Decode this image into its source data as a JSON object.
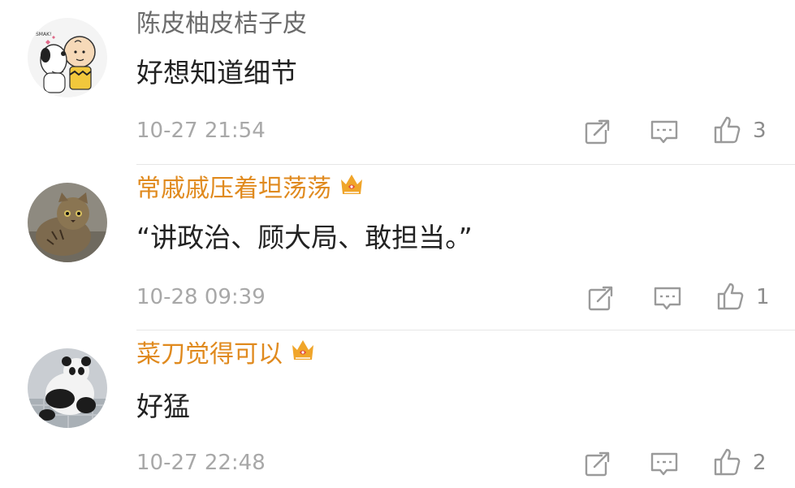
{
  "comments": [
    {
      "username": "陈皮柚皮桔子皮",
      "vip": false,
      "avatar": "snoopy-charlie-brown-avatar",
      "text": "好想知道细节",
      "time": "10-27 21:54",
      "likes": "3"
    },
    {
      "username": "常戚戚压着坦荡荡",
      "vip": true,
      "avatar": "cat-avatar",
      "text": "“讲政治、顾大局、敢担当。”",
      "time": "10-28 09:39",
      "likes": "1"
    },
    {
      "username": "菜刀觉得可以",
      "vip": true,
      "avatar": "panda-avatar",
      "text": "好猛",
      "time": "10-27 22:48",
      "likes": "2"
    }
  ],
  "colors": {
    "vip_name": "#e08a1e",
    "plain_name": "#6b6b6b",
    "time": "#a8a8a8",
    "icon": "#9a9a9a"
  },
  "icons": [
    "share-icon",
    "comment-icon",
    "like-icon",
    "vip-crown-icon"
  ]
}
